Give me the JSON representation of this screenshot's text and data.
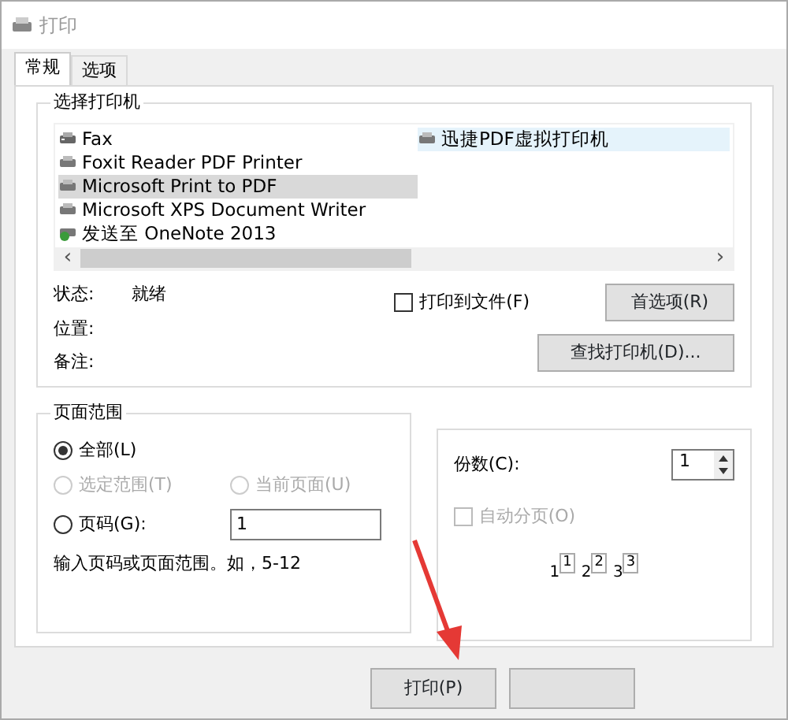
{
  "window": {
    "title": "打印"
  },
  "tabs": [
    {
      "label": "常规",
      "selected": true
    },
    {
      "label": "选项",
      "selected": false
    }
  ],
  "printer_group": {
    "title": "选择打印机",
    "printers": [
      {
        "name": "Fax",
        "kind": "fax",
        "selected": false
      },
      {
        "name": "Foxit Reader PDF Printer",
        "kind": "printer",
        "selected": false
      },
      {
        "name": "Microsoft Print to PDF",
        "kind": "printer",
        "selected": true
      },
      {
        "name": "Microsoft XPS Document Writer",
        "kind": "printer",
        "selected": false
      },
      {
        "name": "发送至 OneNote 2013",
        "kind": "onenote",
        "selected": false
      },
      {
        "name": "迅捷PDF虚拟打印机",
        "kind": "printer",
        "selected": false,
        "hover": true
      }
    ],
    "scroll_left": "‹",
    "scroll_right": "›",
    "status_label": "状态:",
    "status_value": "就绪",
    "location_label": "位置:",
    "comment_label": "备注:",
    "print_to_file": {
      "label": "打印到文件(F)",
      "checked": false
    },
    "preferences_button": "首选项(R)",
    "find_button": "查找打印机(D)..."
  },
  "page_range": {
    "title": "页面范围",
    "options": [
      {
        "label": "全部(L)",
        "selected": true,
        "disabled": false
      },
      {
        "label": "选定范围(T)",
        "selected": false,
        "disabled": true
      },
      {
        "label": "当前页面(U)",
        "selected": false,
        "disabled": true
      },
      {
        "label": "页码(G):",
        "selected": false,
        "disabled": false
      }
    ],
    "pages_value": "1",
    "hint": "输入页码或页面范围。如，5-12"
  },
  "copies": {
    "label": "份数(C):",
    "value": "1",
    "collate": {
      "label": "自动分页(O)",
      "checked": false,
      "disabled": true
    },
    "collate_pages": [
      "1",
      "1",
      "2",
      "2",
      "3",
      "3"
    ]
  },
  "buttons": [
    {
      "kind": "text",
      "label": "打印(P)"
    },
    {
      "kind": "covered"
    }
  ],
  "annotations": [
    {
      "kind": "arrow"
    }
  ]
}
